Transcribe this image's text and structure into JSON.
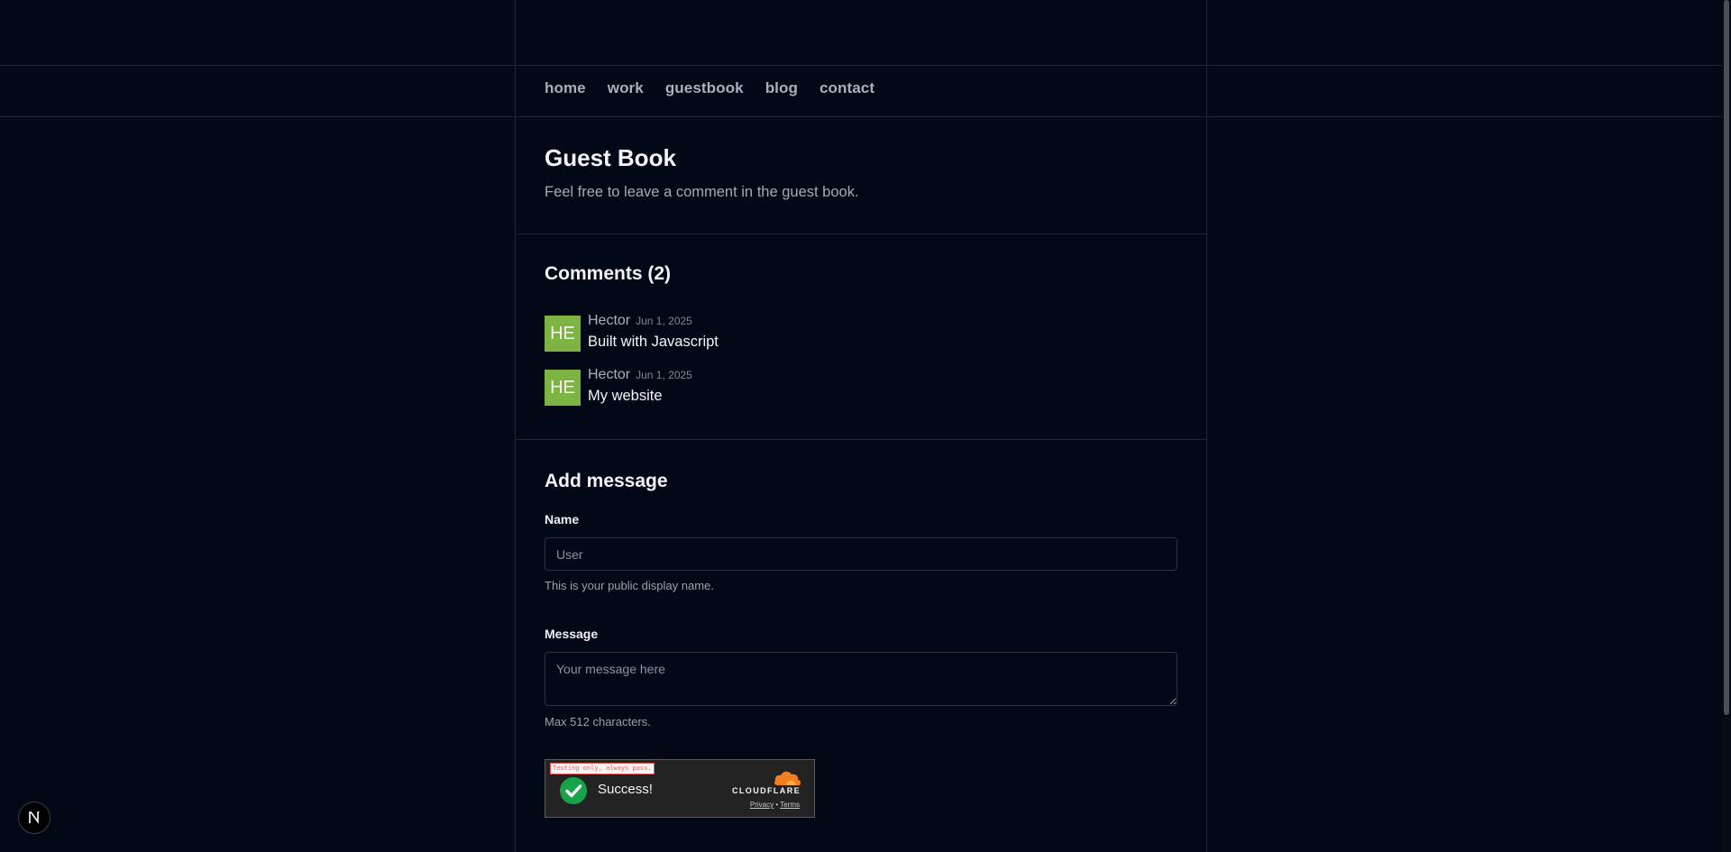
{
  "nav": {
    "items": [
      {
        "label": "home"
      },
      {
        "label": "work"
      },
      {
        "label": "guestbook"
      },
      {
        "label": "blog"
      },
      {
        "label": "contact"
      }
    ]
  },
  "header": {
    "title": "Guest Book",
    "subtitle": "Feel free to leave a comment in the guest book."
  },
  "comments": {
    "title": "Comments (2)",
    "items": [
      {
        "initials": "HE",
        "author": "Hector",
        "date": "Jun 1, 2025",
        "text": "Built with Javascript"
      },
      {
        "initials": "HE",
        "author": "Hector",
        "date": "Jun 1, 2025",
        "text": "My website"
      }
    ]
  },
  "form": {
    "title": "Add message",
    "name_label": "Name",
    "name_placeholder": "User",
    "name_hint": "This is your public display name.",
    "message_label": "Message",
    "message_placeholder": "Your message here",
    "message_hint": "Max 512 characters."
  },
  "captcha": {
    "testing_label": "Testing only, always pass.",
    "status": "Success!",
    "brand": "CLOUDFLARE",
    "privacy": "Privacy",
    "separator": "•",
    "terms": "Terms"
  },
  "colors": {
    "background": "#030817",
    "avatar": "#7cb342",
    "success": "#16a34a",
    "cloudflare": "#f38020"
  },
  "icons": {
    "captcha_status": "check-circle-icon",
    "brand_logo": "cloudflare-cloud-icon",
    "next_badge": "nextjs-n-icon"
  }
}
